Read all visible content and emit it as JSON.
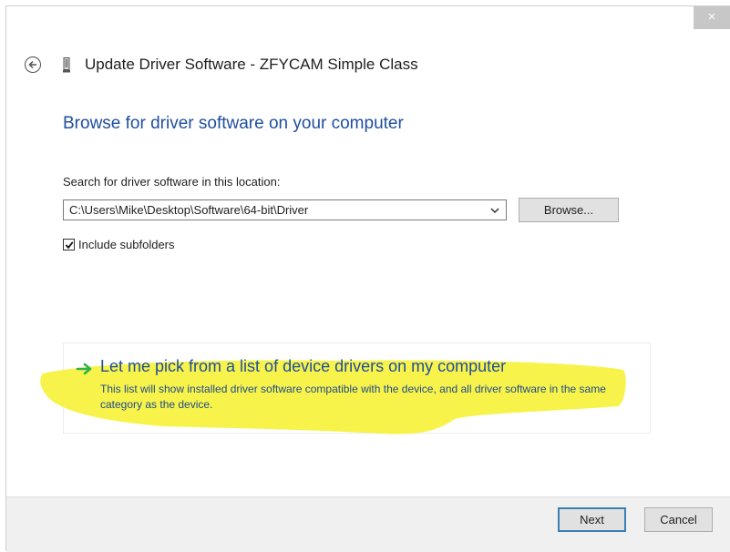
{
  "window": {
    "close_label": "×",
    "title": "Update Driver Software - ZFYCAM Simple Class"
  },
  "page": {
    "heading": "Browse for driver software on your computer",
    "location_label": "Search for driver software in this location:",
    "location_value": "C:\\Users\\Mike\\Desktop\\Software\\64-bit\\Driver",
    "browse_label": "Browse...",
    "include_subfolders_label": "Include subfolders",
    "include_subfolders_checked": true
  },
  "pick_option": {
    "title": "Let me pick from a list of device drivers on my computer",
    "description": "This list will show installed driver software compatible with the device, and all driver software in the same category as the device."
  },
  "footer": {
    "next_label": "Next",
    "cancel_label": "Cancel"
  },
  "colors": {
    "accent_blue": "#1f4e9d",
    "arrow_green": "#2fb24a",
    "highlight_yellow": "#f6f23c"
  },
  "icons": {
    "back": "back-arrow-icon",
    "device": "device-icon",
    "dropdown": "chevron-down-icon",
    "check": "checkmark-icon",
    "pick": "green-arrow-icon",
    "close": "close-icon"
  }
}
